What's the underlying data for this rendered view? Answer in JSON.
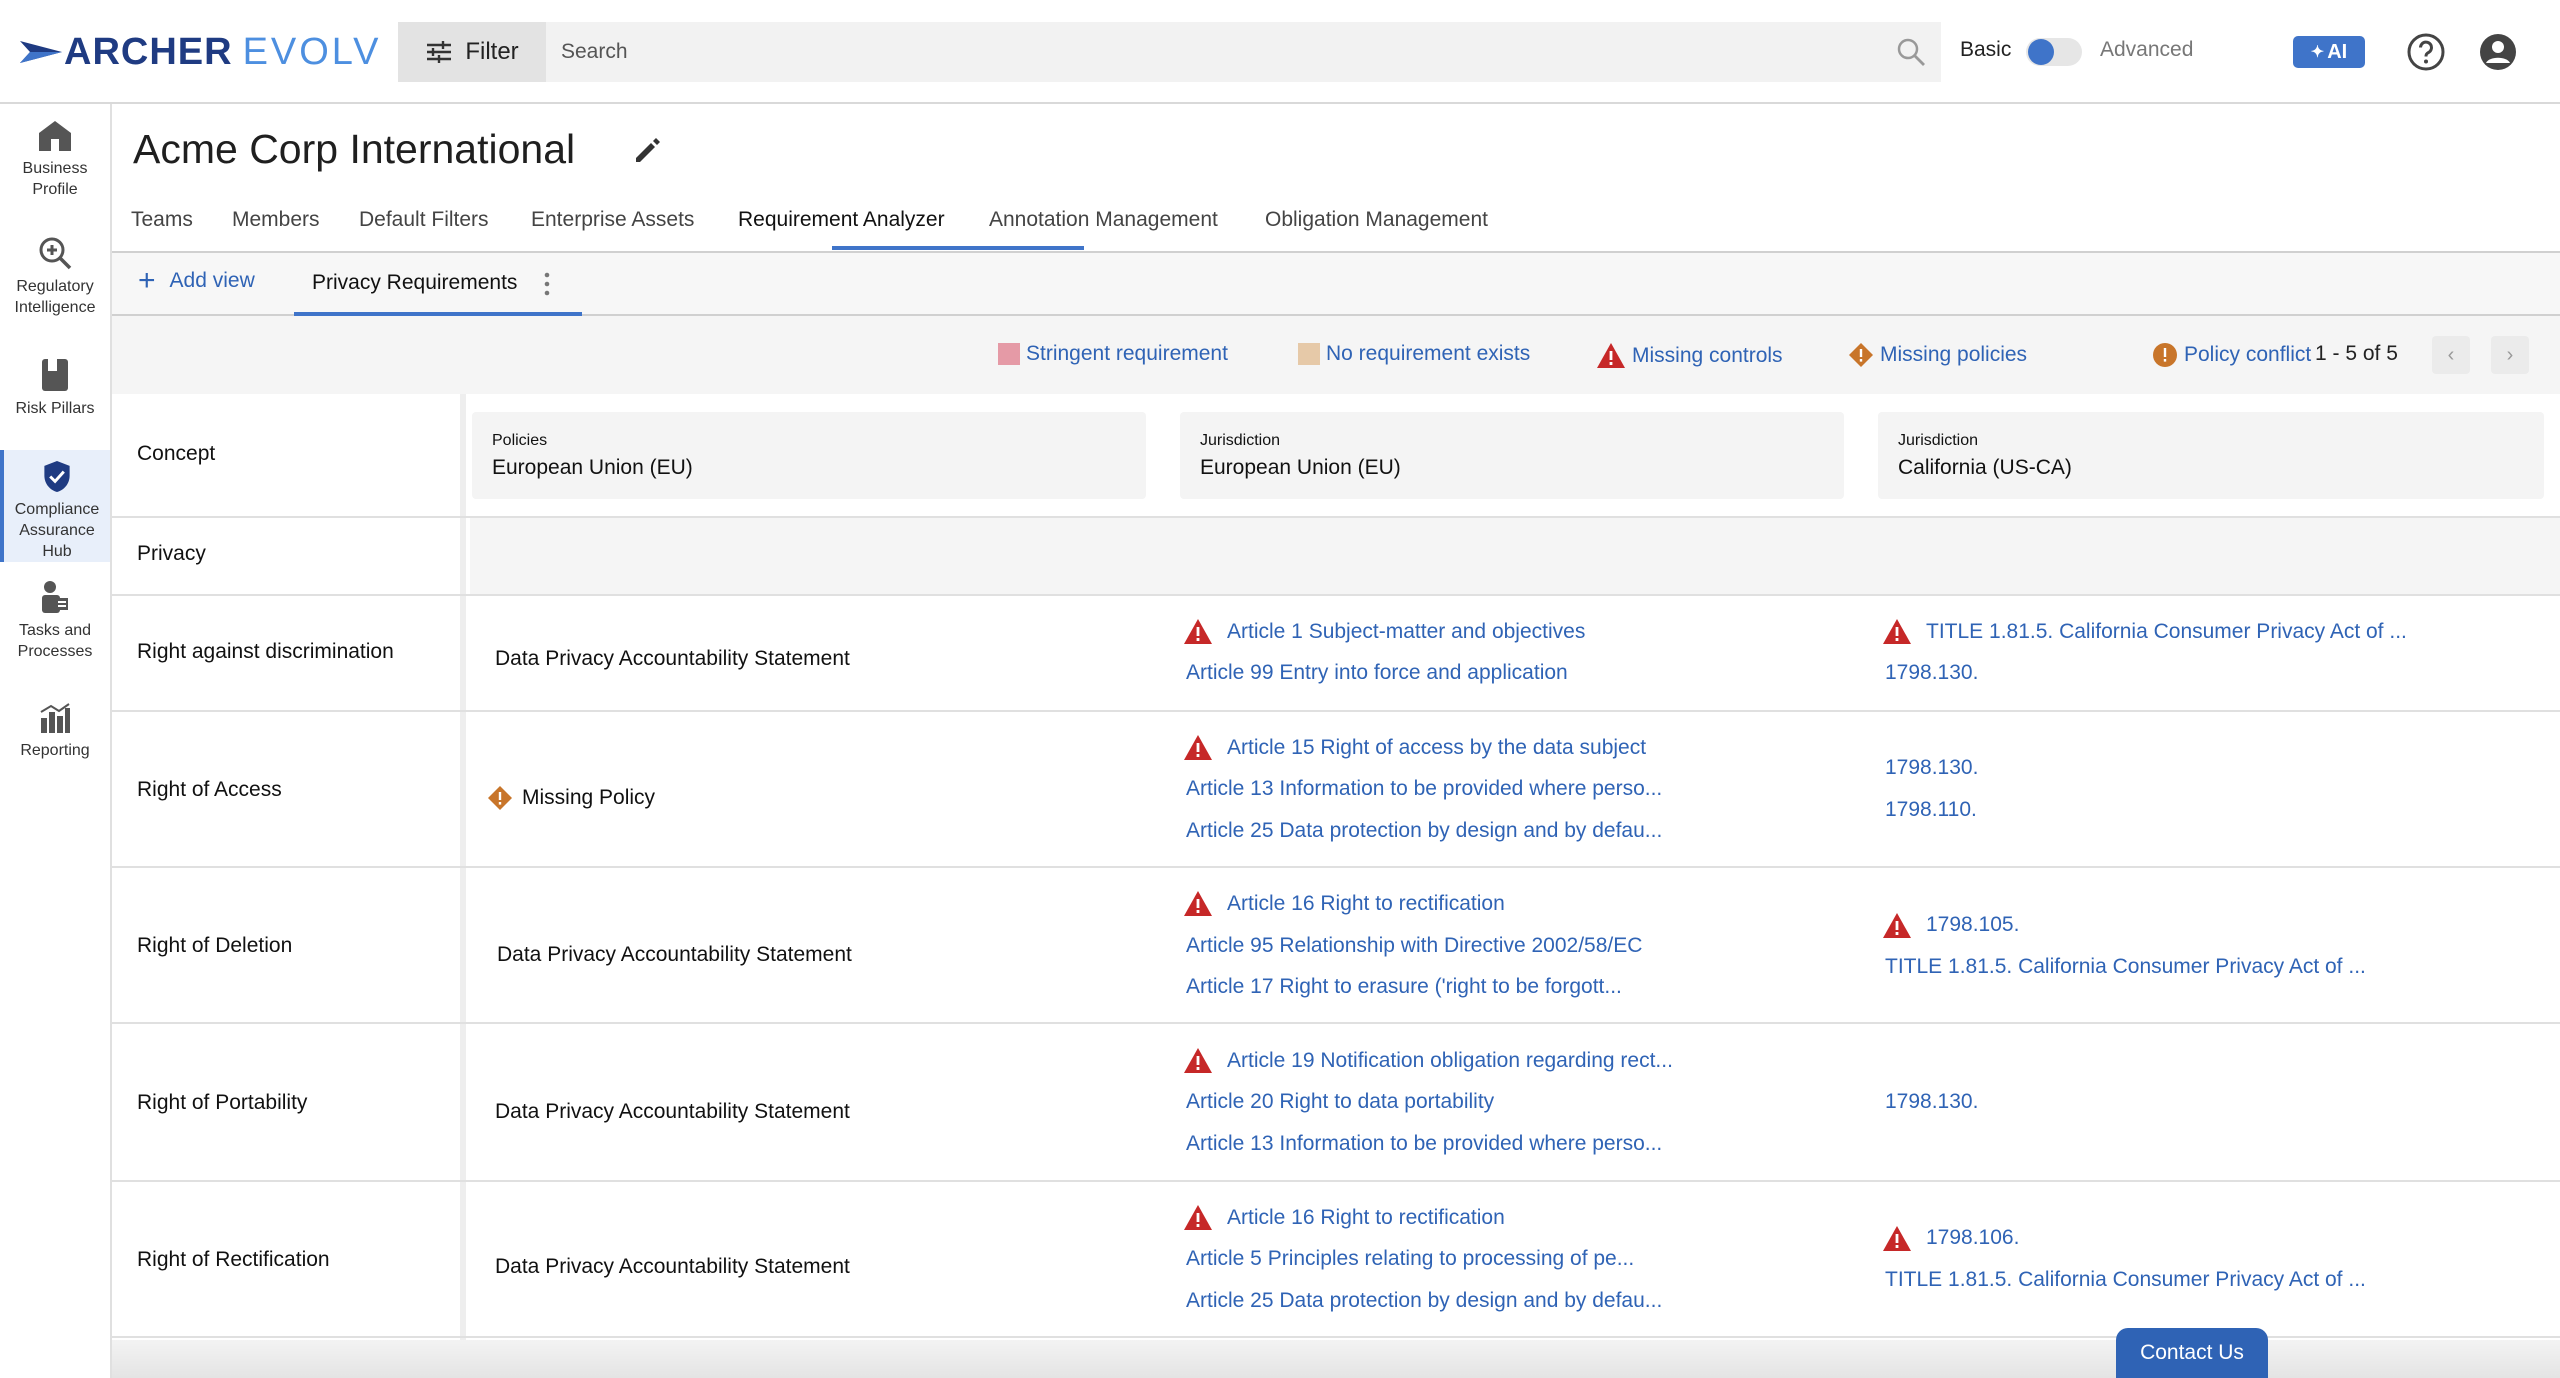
{
  "brand": {
    "name_primary": "ARCHER",
    "name_secondary": "EVOLV"
  },
  "topbar": {
    "filter_label": "Filter",
    "search_placeholder": "Search",
    "mode_basic": "Basic",
    "mode_advanced": "Advanced",
    "ai_label": "AI"
  },
  "leftnav": [
    {
      "l1": "Business",
      "l2": "Profile",
      "l3": ""
    },
    {
      "l1": "Regulatory",
      "l2": "Intelligence",
      "l3": ""
    },
    {
      "l1": "Risk Pillars",
      "l2": "",
      "l3": ""
    },
    {
      "l1": "Compliance",
      "l2": "Assurance",
      "l3": "Hub"
    },
    {
      "l1": "Tasks and",
      "l2": "Processes",
      "l3": ""
    },
    {
      "l1": "Reporting",
      "l2": "",
      "l3": ""
    }
  ],
  "page": {
    "title": "Acme Corp International"
  },
  "tabs": [
    "Teams",
    "Members",
    "Default Filters",
    "Enterprise Assets",
    "Requirement Analyzer",
    "Annotation Management",
    "Obligation Management"
  ],
  "views": {
    "add_label": "Add view",
    "current": "Privacy Requirements"
  },
  "legend": {
    "stringent": "Stringent requirement",
    "no_req": "No requirement exists",
    "missing_controls": "Missing controls",
    "missing_policies": "Missing policies",
    "policy_conflict": "Policy conflict",
    "pager": "1 - 5 of 5"
  },
  "colors": {
    "accent": "#3f74c9",
    "link": "#2f63b5",
    "warn_red": "#c62828",
    "policy_orange": "#c8752a",
    "stringent": "#e59aa6",
    "no_req": "#e6c9a8"
  },
  "grid": {
    "concept_header": "Concept",
    "group": "Privacy",
    "columns": [
      {
        "kind": "Policies",
        "name": "European Union (EU)"
      },
      {
        "kind": "Jurisdiction",
        "name": "European Union (EU)"
      },
      {
        "kind": "Jurisdiction",
        "name": "California (US-CA)"
      }
    ],
    "rows": [
      {
        "concept": "Right against discrimination",
        "policy": "Data Privacy Accountability Statement",
        "eu": [
          "Article 1 Subject-matter and objectives",
          "Article 99 Entry into force and application"
        ],
        "ca": [
          "TITLE 1.81.5. California Consumer Privacy Act of ...",
          "1798.130."
        ]
      },
      {
        "concept": "Right of Access",
        "policy": "Missing Policy",
        "eu": [
          "Article 15 Right of access by the data subject",
          "Article 13 Information to be provided where perso...",
          "Article 25 Data protection by design and by defau..."
        ],
        "ca": [
          "1798.130.",
          "1798.110."
        ]
      },
      {
        "concept": "Right of Deletion",
        "policy": "Data Privacy Accountability Statement",
        "eu": [
          "Article 16 Right to rectification",
          "Article 95 Relationship with Directive 2002/58/EC",
          "Article 17 Right to erasure ('right to be forgott..."
        ],
        "ca": [
          "1798.105.",
          "TITLE 1.81.5. California Consumer Privacy Act of ..."
        ]
      },
      {
        "concept": "Right of Portability",
        "policy": "Data Privacy Accountability Statement",
        "eu": [
          "Article 19 Notification obligation regarding rect...",
          "Article 20 Right to data portability",
          "Article 13 Information to be provided where perso..."
        ],
        "ca": [
          "1798.130."
        ]
      },
      {
        "concept": "Right of Rectification",
        "policy": "Data Privacy Accountability Statement",
        "eu": [
          "Article 16 Right to rectification",
          "Article 5 Principles relating to processing of pe...",
          "Article 25 Data protection by design and by defau..."
        ],
        "ca": [
          "1798.106.",
          "TITLE 1.81.5. California Consumer Privacy Act of ..."
        ]
      }
    ]
  },
  "footer": {
    "contact": "Contact Us"
  }
}
